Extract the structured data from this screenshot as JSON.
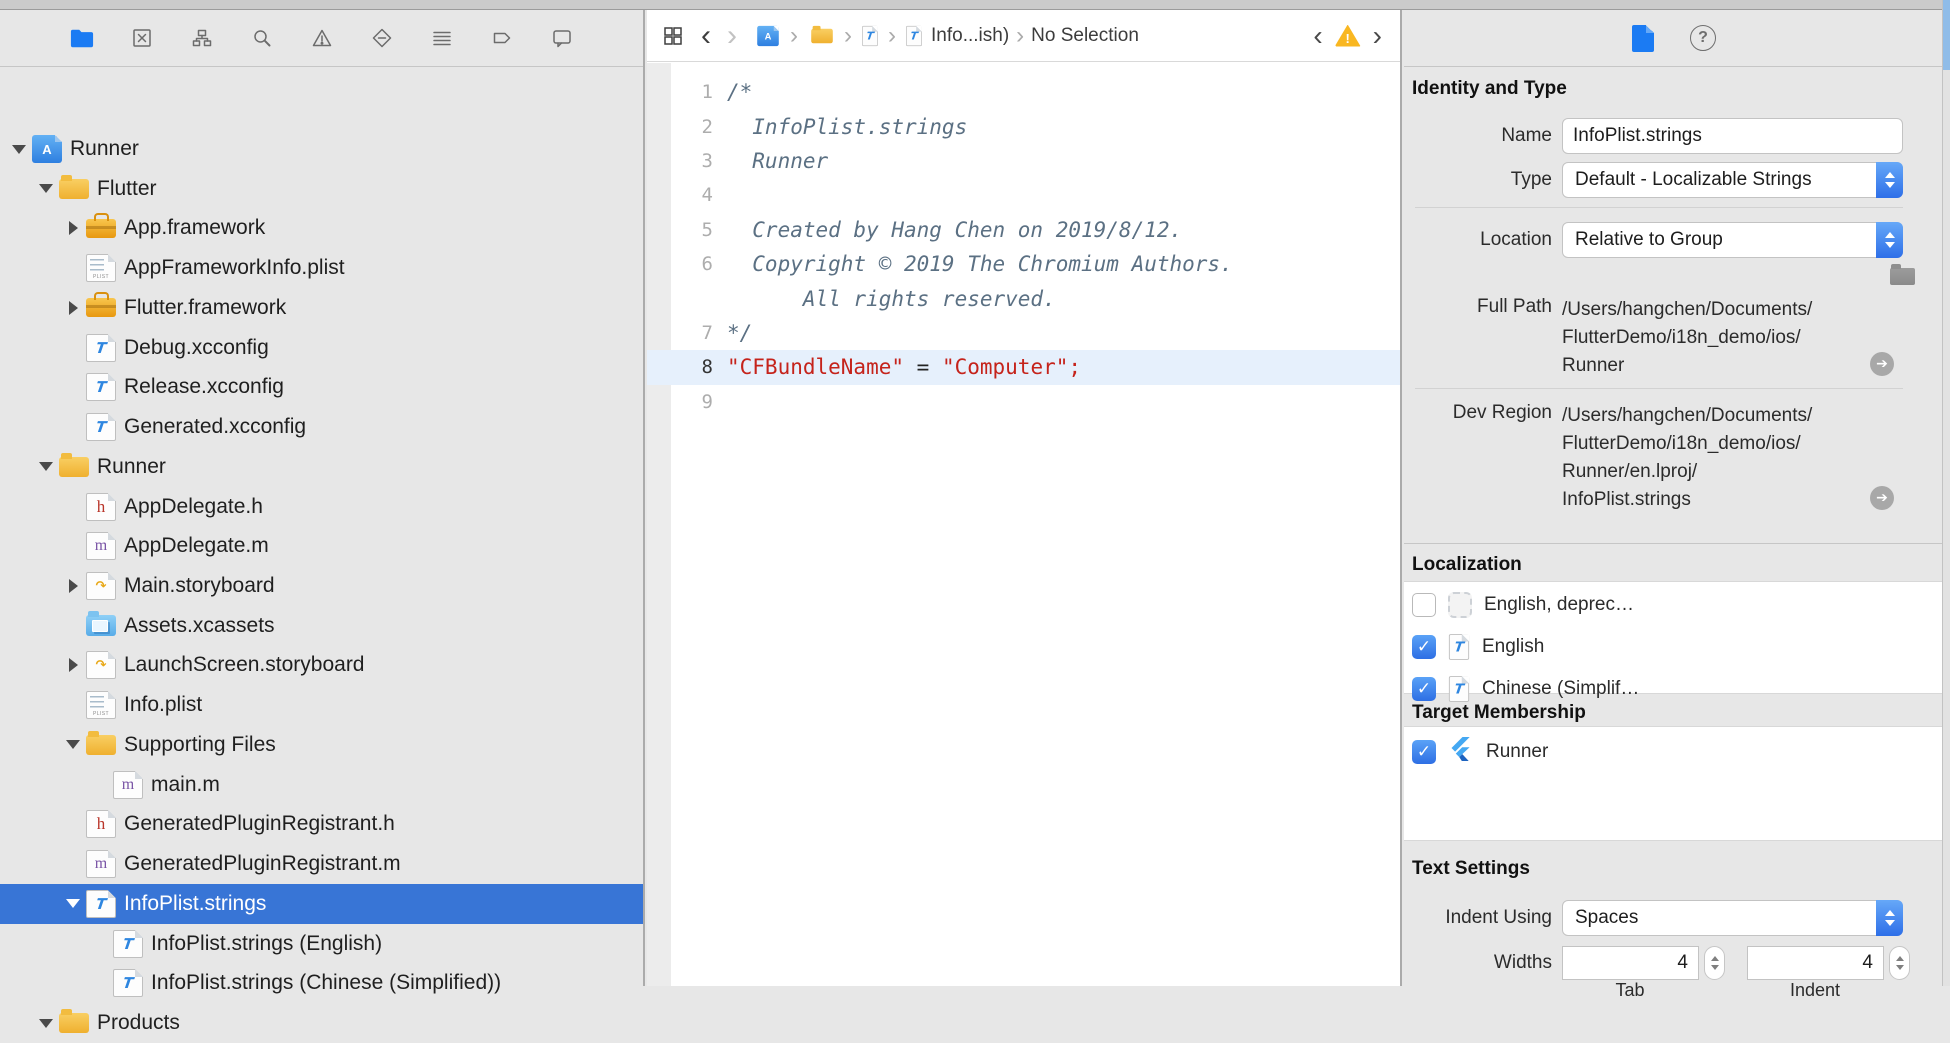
{
  "navigator": {
    "toolbar_icons": [
      {
        "name": "project-navigator-icon",
        "selected": true
      },
      {
        "name": "source-control-navigator-icon",
        "selected": false
      },
      {
        "name": "symbol-navigator-icon",
        "selected": false
      },
      {
        "name": "find-navigator-icon",
        "selected": false
      },
      {
        "name": "issue-navigator-icon",
        "selected": false
      },
      {
        "name": "test-navigator-icon",
        "selected": false
      },
      {
        "name": "debug-navigator-icon",
        "selected": false
      },
      {
        "name": "breakpoint-navigator-icon",
        "selected": false
      },
      {
        "name": "report-navigator-icon",
        "selected": false
      }
    ],
    "tree": [
      {
        "slug": "runner-project",
        "label": "Runner",
        "icon": "xcodeproj",
        "level": 0,
        "disclosure": "open",
        "selected": false
      },
      {
        "slug": "flutter-folder",
        "label": "Flutter",
        "icon": "folder",
        "level": 1,
        "disclosure": "open",
        "selected": false
      },
      {
        "slug": "app-framework",
        "label": "App.framework",
        "icon": "framework",
        "level": 2,
        "disclosure": "closed",
        "selected": false
      },
      {
        "slug": "appframeworkinfo-plist",
        "label": "AppFrameworkInfo.plist",
        "icon": "plist",
        "level": 2,
        "disclosure": "none",
        "selected": false
      },
      {
        "slug": "flutter-framework",
        "label": "Flutter.framework",
        "icon": "framework",
        "level": 2,
        "disclosure": "closed",
        "selected": false
      },
      {
        "slug": "debug-xcconfig",
        "label": "Debug.xcconfig",
        "icon": "xcconfig",
        "level": 2,
        "disclosure": "none",
        "selected": false
      },
      {
        "slug": "release-xcconfig",
        "label": "Release.xcconfig",
        "icon": "xcconfig",
        "level": 2,
        "disclosure": "none",
        "selected": false
      },
      {
        "slug": "generated-xcconfig",
        "label": "Generated.xcconfig",
        "icon": "xcconfig",
        "level": 2,
        "disclosure": "none",
        "selected": false
      },
      {
        "slug": "runner-folder",
        "label": "Runner",
        "icon": "folder",
        "level": 1,
        "disclosure": "open",
        "selected": false
      },
      {
        "slug": "appdelegate-h",
        "label": "AppDelegate.h",
        "icon": "h",
        "level": 2,
        "disclosure": "none",
        "selected": false
      },
      {
        "slug": "appdelegate-m",
        "label": "AppDelegate.m",
        "icon": "m",
        "level": 2,
        "disclosure": "none",
        "selected": false
      },
      {
        "slug": "main-storyboard",
        "label": "Main.storyboard",
        "icon": "storyboard",
        "level": 2,
        "disclosure": "closed",
        "selected": false
      },
      {
        "slug": "assets-xcassets",
        "label": "Assets.xcassets",
        "icon": "xcassets",
        "level": 2,
        "disclosure": "none",
        "selected": false
      },
      {
        "slug": "launchscreen-storyboard",
        "label": "LaunchScreen.storyboard",
        "icon": "storyboard",
        "level": 2,
        "disclosure": "closed",
        "selected": false
      },
      {
        "slug": "info-plist",
        "label": "Info.plist",
        "icon": "plist",
        "level": 2,
        "disclosure": "none",
        "selected": false
      },
      {
        "slug": "supporting-files",
        "label": "Supporting Files",
        "icon": "folder",
        "level": 2,
        "disclosure": "open",
        "selected": false
      },
      {
        "slug": "main-m",
        "label": "main.m",
        "icon": "m",
        "level": 3,
        "disclosure": "none",
        "selected": false
      },
      {
        "slug": "generatedpluginregistrant-h",
        "label": "GeneratedPluginRegistrant.h",
        "icon": "h",
        "level": 2,
        "disclosure": "none",
        "selected": false
      },
      {
        "slug": "generatedpluginregistrant-m",
        "label": "GeneratedPluginRegistrant.m",
        "icon": "m",
        "level": 2,
        "disclosure": "none",
        "selected": false
      },
      {
        "slug": "infoplist-strings",
        "label": "InfoPlist.strings",
        "icon": "strings",
        "level": 2,
        "disclosure": "open",
        "selected": true
      },
      {
        "slug": "infoplist-strings-english",
        "label": "InfoPlist.strings (English)",
        "icon": "strings",
        "level": 3,
        "disclosure": "none",
        "selected": false
      },
      {
        "slug": "infoplist-strings-chinese",
        "label": "InfoPlist.strings (Chinese (Simplified))",
        "icon": "strings",
        "level": 3,
        "disclosure": "none",
        "selected": false
      },
      {
        "slug": "products-folder",
        "label": "Products",
        "icon": "folder",
        "level": 1,
        "disclosure": "open",
        "selected": false
      }
    ]
  },
  "jumpbar": {
    "crumb_file": "Info...ish)",
    "crumb_selection": "No Selection"
  },
  "editor": {
    "rows": [
      {
        "num": "1",
        "current": false,
        "segs": [
          {
            "t": "/*",
            "c": "cm"
          }
        ]
      },
      {
        "num": "2",
        "current": false,
        "segs": [
          {
            "t": "  InfoPlist.strings",
            "c": "cm"
          }
        ]
      },
      {
        "num": "3",
        "current": false,
        "segs": [
          {
            "t": "  Runner",
            "c": "cm"
          }
        ]
      },
      {
        "num": "4",
        "current": false,
        "segs": []
      },
      {
        "num": "5",
        "current": false,
        "segs": [
          {
            "t": "  Created by Hang Chen on 2019/8/12.",
            "c": "cm"
          }
        ]
      },
      {
        "num": "6",
        "current": false,
        "segs": [
          {
            "t": "  Copyright © 2019 The Chromium Authors.",
            "c": "cm"
          }
        ]
      },
      {
        "num": "",
        "current": false,
        "segs": [
          {
            "t": "      All rights reserved.",
            "c": "cm"
          }
        ]
      },
      {
        "num": "7",
        "current": false,
        "segs": [
          {
            "t": "*/",
            "c": "cm"
          }
        ]
      },
      {
        "num": "8",
        "current": true,
        "segs": [
          {
            "t": "\"CFBundleName\"",
            "c": "str"
          },
          {
            "t": " = ",
            "c": "pln"
          },
          {
            "t": "\"Computer\"",
            "c": "str"
          },
          {
            "t": ";",
            "c": "str"
          }
        ]
      },
      {
        "num": "9",
        "current": false,
        "segs": []
      }
    ]
  },
  "inspector": {
    "identity_heading": "Identity and Type",
    "name_label": "Name",
    "name_value": "InfoPlist.strings",
    "type_label": "Type",
    "type_value": "Default - Localizable Strings",
    "location_label": "Location",
    "location_value": "Relative to Group",
    "full_path_label": "Full Path",
    "full_path_lines": [
      "/Users/hangchen/Documents/",
      "FlutterDemo/i18n_demo/ios/",
      "Runner"
    ],
    "dev_region_label": "Dev Region",
    "dev_region_lines": [
      "/Users/hangchen/Documents/",
      "FlutterDemo/i18n_demo/ios/",
      "Runner/en.lproj/",
      "InfoPlist.strings"
    ],
    "localization_heading": "Localization",
    "localizations": [
      {
        "label": "English, deprec…",
        "checked": false,
        "icon": "dashed-placeholder"
      },
      {
        "label": "English",
        "checked": true,
        "icon": "strings-file"
      },
      {
        "label": "Chinese (Simplif…",
        "checked": true,
        "icon": "strings-file"
      }
    ],
    "target_heading": "Target Membership",
    "targets": [
      {
        "label": "Runner",
        "checked": true,
        "icon": "flutter-logo"
      }
    ],
    "text_settings_heading": "Text Settings",
    "indent_label": "Indent Using",
    "indent_value": "Spaces",
    "widths_label": "Widths",
    "width_tab": "4",
    "width_indent": "4",
    "tab_sub_label": "Tab",
    "indent_sub_label": "Indent"
  },
  "colors": {
    "selection_blue": "#3875D6",
    "control_blue": "#2E6FE8",
    "string_red": "#C5231B",
    "comment_gray_blue": "#5B7083",
    "warning_yellow": "#F9B721"
  }
}
